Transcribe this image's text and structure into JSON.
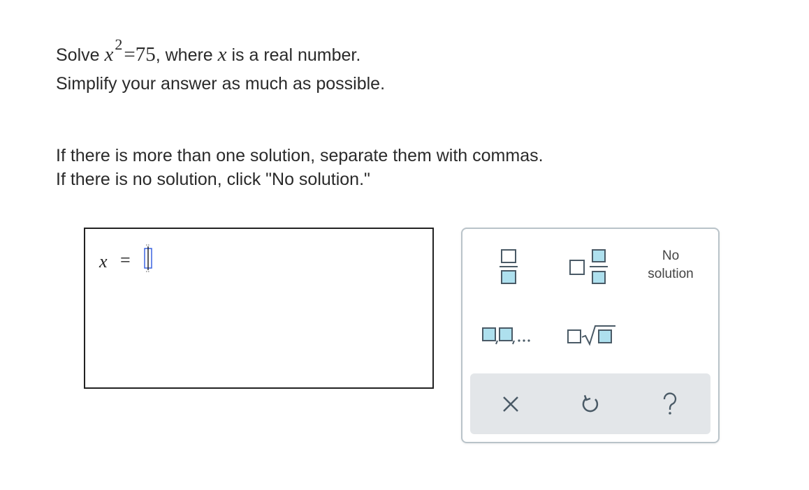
{
  "problem": {
    "prefix": "Solve ",
    "var": "x",
    "exponent": "2",
    "equals_value": "=75",
    "suffix_a": ", where ",
    "var2": "x",
    "suffix_b": " is a real number.",
    "line2": "Simplify your answer as much as possible."
  },
  "instructions": {
    "line1": "If there is more than one solution, separate them with commas.",
    "line2": "If there is no solution, click \"No solution.\""
  },
  "answer": {
    "variable": "x",
    "equals": "=",
    "value": ""
  },
  "keypad": {
    "no_solution_line1": "No",
    "no_solution_line2": "solution",
    "keys": [
      "fraction-icon",
      "mixed-number-icon",
      "list-icon",
      "nth-root-icon"
    ],
    "tray": [
      "clear-icon",
      "undo-icon",
      "help-icon"
    ],
    "colors": {
      "box_fill": "#aee0ee",
      "box_stroke": "#4a5a66",
      "border": "#b9c3c9",
      "tray_bg": "#e3e6e9",
      "cursor": "#3b63e0"
    }
  }
}
